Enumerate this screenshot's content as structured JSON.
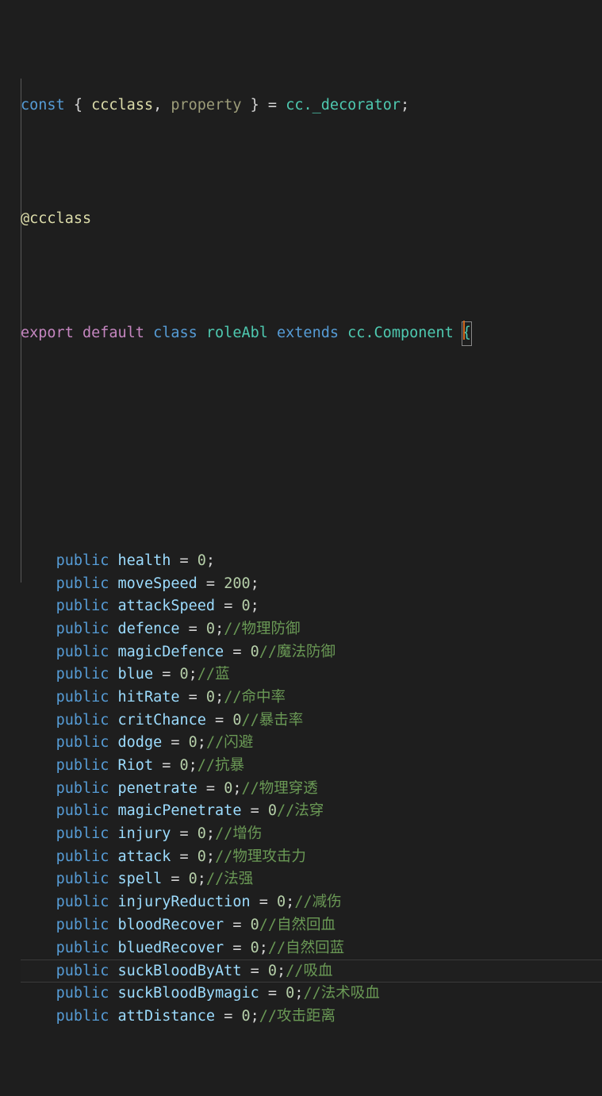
{
  "editor": {
    "background_color": "#1e1e1e",
    "foreground_color": "#d4d4d4",
    "current_line_index": 18,
    "indent_guide_color": "#646464",
    "language": "TypeScript"
  },
  "colors": {
    "keyword": "#569cd6",
    "modifier_keyword": "#c586c0",
    "type": "#4ec9b0",
    "function": "#dcdcaa",
    "unused_identifier": "#9d9d79",
    "variable": "#9cdcfe",
    "number": "#b5cea8",
    "comment": "#6a9955",
    "punctuation": "#d4d4d4",
    "current_line_border": "#3a3a3a",
    "bracket_match_border": "#888888",
    "cursor": "#d2691e"
  },
  "code": {
    "line01": {
      "kw_const": "const",
      "brace_open": " { ",
      "ccclass": "ccclass",
      "comma": ", ",
      "property": "property",
      "brace_close": " } ",
      "equals": "= ",
      "decorator_ref": "cc._decorator",
      "semicolon": ";"
    },
    "line02": {
      "decorator": "@ccclass"
    },
    "line03": {
      "export_default": "export default",
      "kw_class": " class ",
      "class_name": "roleAbl",
      "kw_extends": " extends ",
      "base_class": "cc.Component",
      "brace": "{"
    },
    "properties": [
      {
        "modifier": "public",
        "name": "health",
        "op": " = ",
        "value": "0",
        "terminator": ";",
        "comment": ""
      },
      {
        "modifier": "public",
        "name": "moveSpeed",
        "op": " = ",
        "value": "200",
        "terminator": ";",
        "comment": ""
      },
      {
        "modifier": "public",
        "name": "attackSpeed",
        "op": " = ",
        "value": "0",
        "terminator": ";",
        "comment": ""
      },
      {
        "modifier": "public",
        "name": "defence",
        "op": " = ",
        "value": "0",
        "terminator": ";",
        "comment": "//物理防御"
      },
      {
        "modifier": "public",
        "name": "magicDefence",
        "op": " = ",
        "value": "0",
        "terminator": "",
        "comment": "//魔法防御"
      },
      {
        "modifier": "public",
        "name": "blue",
        "op": " = ",
        "value": "0",
        "terminator": ";",
        "comment": "//蓝"
      },
      {
        "modifier": "public",
        "name": "hitRate",
        "op": " = ",
        "value": "0",
        "terminator": ";",
        "comment": "//命中率"
      },
      {
        "modifier": "public",
        "name": "critChance",
        "op": " = ",
        "value": "0",
        "terminator": "",
        "comment": "//暴击率"
      },
      {
        "modifier": "public",
        "name": "dodge",
        "op": " = ",
        "value": "0",
        "terminator": ";",
        "comment": "//闪避"
      },
      {
        "modifier": "public",
        "name": "Riot",
        "op": " = ",
        "value": "0",
        "terminator": ";",
        "comment": "//抗暴"
      },
      {
        "modifier": "public",
        "name": "penetrate",
        "op": " = ",
        "value": "0",
        "terminator": ";",
        "comment": "//物理穿透"
      },
      {
        "modifier": "public",
        "name": "magicPenetrate",
        "op": " = ",
        "value": "0",
        "terminator": "",
        "comment": "//法穿"
      },
      {
        "modifier": "public",
        "name": "injury",
        "op": " = ",
        "value": "0",
        "terminator": ";",
        "comment": "//增伤"
      },
      {
        "modifier": "public",
        "name": "attack",
        "op": " = ",
        "value": "0",
        "terminator": ";",
        "comment": "//物理攻击力"
      },
      {
        "modifier": "public",
        "name": "spell",
        "op": " = ",
        "value": "0",
        "terminator": ";",
        "comment": "//法强"
      },
      {
        "modifier": "public",
        "name": "injuryReduction",
        "op": " = ",
        "value": "0",
        "terminator": ";",
        "comment": "//减伤"
      },
      {
        "modifier": "public",
        "name": "bloodRecover",
        "op": " = ",
        "value": "0",
        "terminator": "",
        "comment": "//自然回血"
      },
      {
        "modifier": "public",
        "name": "bluedRecover",
        "op": " = ",
        "value": "0",
        "terminator": ";",
        "comment": "//自然回蓝"
      },
      {
        "modifier": "public",
        "name": "suckBloodByAtt",
        "op": " = ",
        "value": "0",
        "terminator": ";",
        "comment": "//吸血"
      },
      {
        "modifier": "public",
        "name": "suckBloodBymagic",
        "op": " = ",
        "value": "0",
        "terminator": ";",
        "comment": "//法术吸血"
      },
      {
        "modifier": "public",
        "name": "attDistance",
        "op": " = ",
        "value": "0",
        "terminator": ";",
        "comment": "//攻击距离"
      }
    ],
    "indent": "    "
  }
}
